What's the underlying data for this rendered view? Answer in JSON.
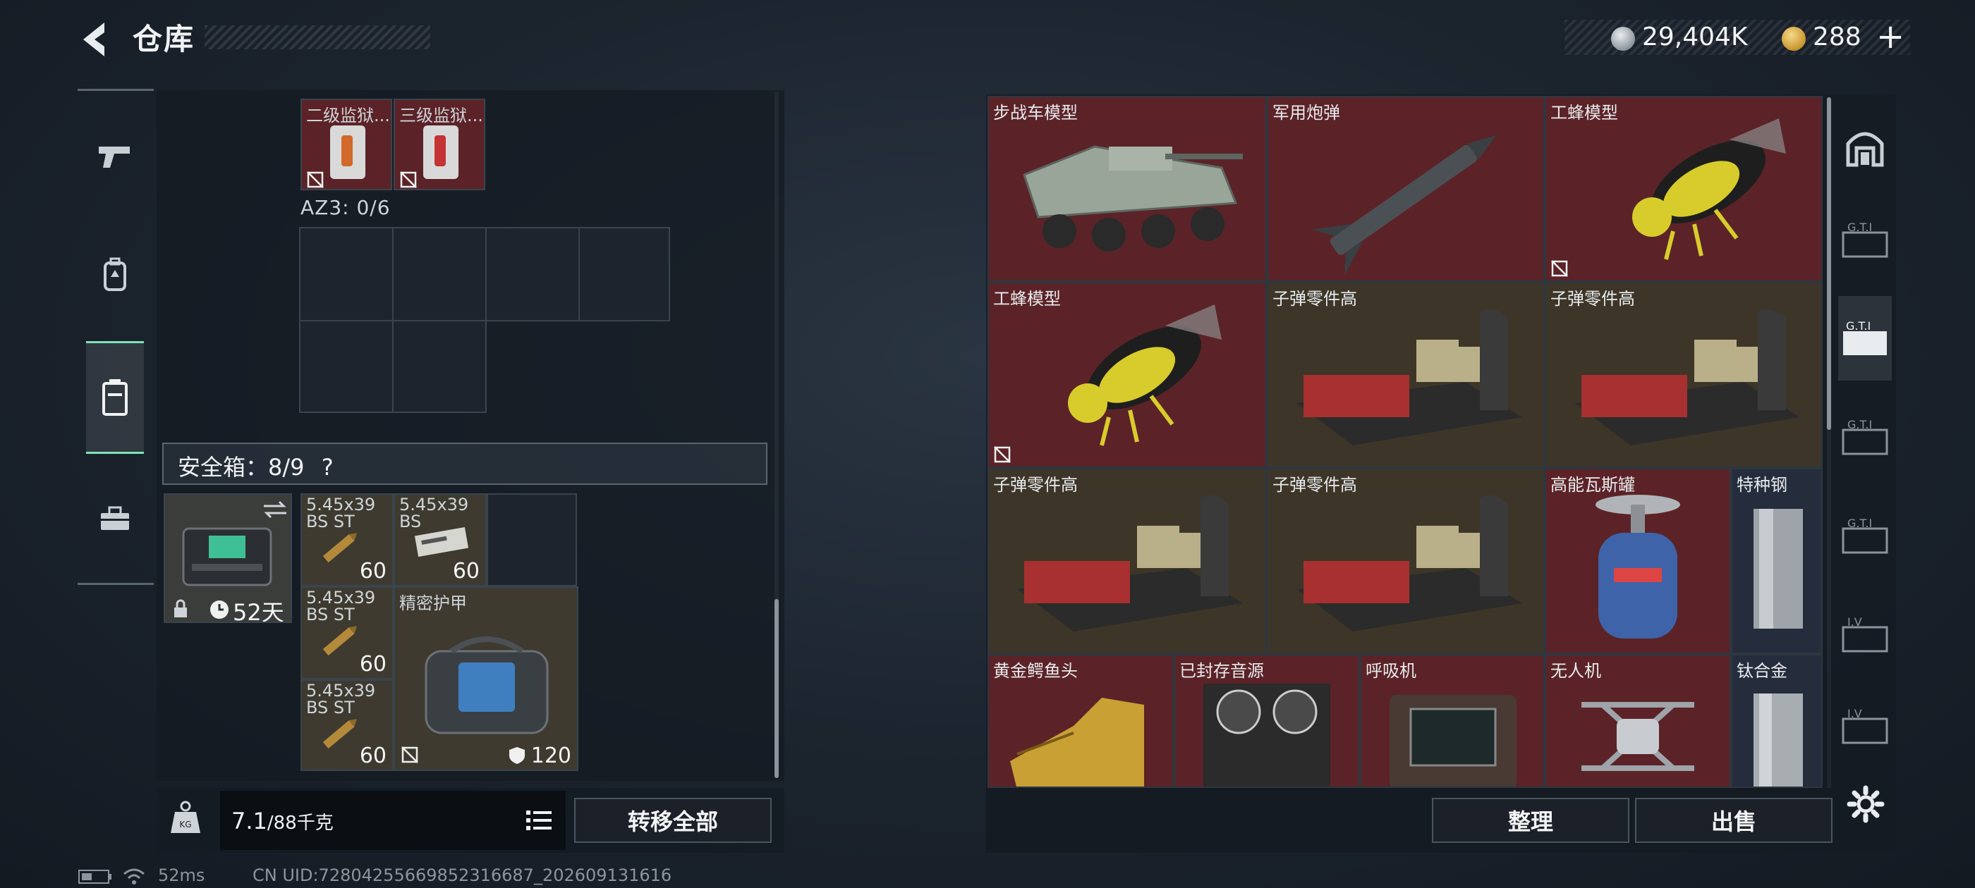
{
  "header": {
    "title": "仓库",
    "currency1": "29,404K",
    "currency2": "288",
    "plus": "+"
  },
  "left_panel": {
    "top_items": [
      {
        "name": "二级监狱..."
      },
      {
        "name": "三级监狱..."
      }
    ],
    "az3_label": "AZ3: 0/6",
    "safe_box_label": "安全箱：8/9",
    "safe_box_help": "?",
    "safe_case": {
      "timer": "52天"
    },
    "ammo_items": [
      {
        "name": "5.45x39 BS ST",
        "count": "60"
      },
      {
        "name": "5.45x39 BS",
        "count": "60"
      },
      {
        "name": "5.45x39 BS ST",
        "count": "60"
      },
      {
        "name": "5.45x39 BS ST",
        "count": "60"
      }
    ],
    "armor_item": {
      "name": "精密护甲",
      "durability": "120"
    },
    "weight": {
      "current": "7.1",
      "max": "/88千克"
    },
    "transfer_all": "转移全部"
  },
  "status": {
    "ping": "52ms",
    "uid": "CN UID:7280425566985231668​7_202609131616"
  },
  "right_panel": {
    "items": [
      {
        "name": "步战车模型",
        "bg": "red"
      },
      {
        "name": "军用炮弹",
        "bg": "red"
      },
      {
        "name": "工蜂模型",
        "bg": "red"
      },
      {
        "name": "工蜂模型",
        "bg": "red"
      },
      {
        "name": "子弹零件高",
        "bg": "brown"
      },
      {
        "name": "子弹零件高",
        "bg": "brown"
      },
      {
        "name": "子弹零件高",
        "bg": "brown"
      },
      {
        "name": "子弹零件高",
        "bg": "brown"
      },
      {
        "name": "高能瓦斯罐",
        "bg": "red"
      },
      {
        "name": "特种钢",
        "bg": "navy"
      },
      {
        "name": "黄金鳄鱼头",
        "bg": "red"
      },
      {
        "name": "已封存音源",
        "bg": "red"
      },
      {
        "name": "呼吸机",
        "bg": "red"
      },
      {
        "name": "无人机",
        "bg": "red"
      },
      {
        "name": "钛合金",
        "bg": "navy"
      }
    ],
    "sort_button": "整理",
    "sell_button": "出售"
  },
  "colors": {
    "accent": "#7de3b9",
    "item_red": "#5b2327",
    "item_brown": "#3d3628",
    "item_navy": "#252c3c"
  }
}
